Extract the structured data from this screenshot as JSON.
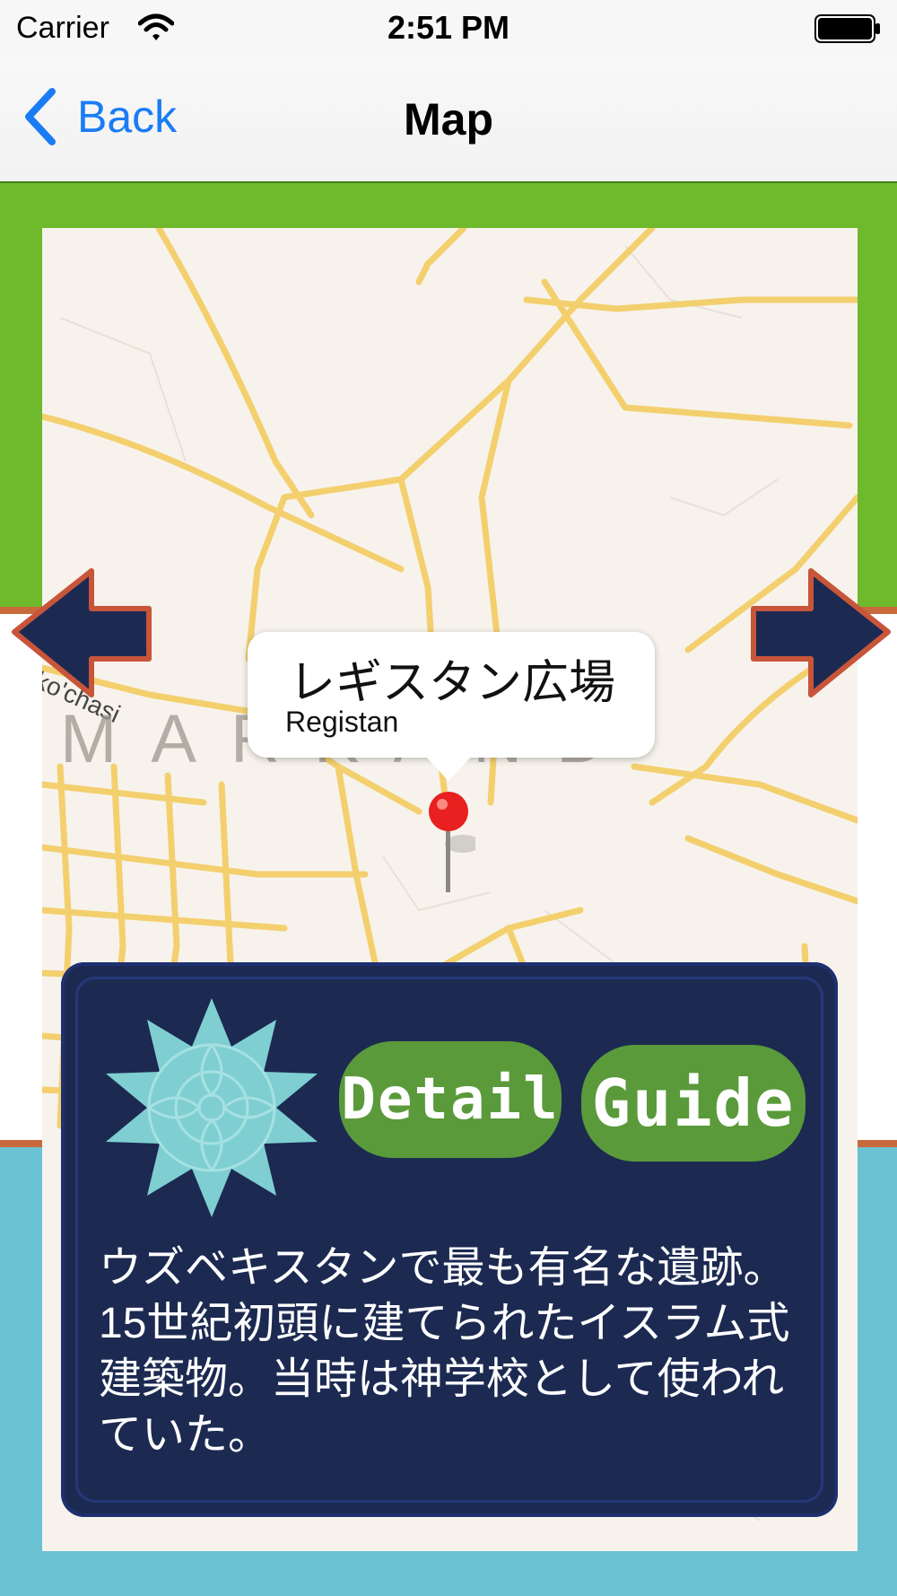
{
  "status_bar": {
    "carrier": "Carrier",
    "time": "2:51 PM"
  },
  "nav": {
    "back_label": "Back",
    "title": "Map"
  },
  "map": {
    "street_label": "ko'chasi",
    "city_label": "MARKAND",
    "callout": {
      "title": "レギスタン広場",
      "subtitle": "Registan"
    }
  },
  "info_card": {
    "detail_label": "Detail",
    "guide_label": "Guide",
    "description": "ウズベキスタンで最も有名な遺跡。15世紀初頭に建てられたイスラム式建築物。当時は神学校として使われていた。"
  },
  "colors": {
    "ios_blue": "#1a7cf5",
    "green_band": "#6fb92c",
    "blue_band": "#6ac2d2",
    "card_navy": "#1c2a52",
    "pill_green": "#5a9a3a",
    "pin_red": "#e8201f",
    "road_yellow": "#f3cf6e"
  },
  "icons": {
    "back": "chevron-left-icon",
    "wifi": "wifi-icon",
    "battery": "battery-icon",
    "pin": "map-pin-icon",
    "prev": "arrow-left-icon",
    "next": "arrow-right-icon",
    "rosette": "flower-rosette-icon"
  }
}
